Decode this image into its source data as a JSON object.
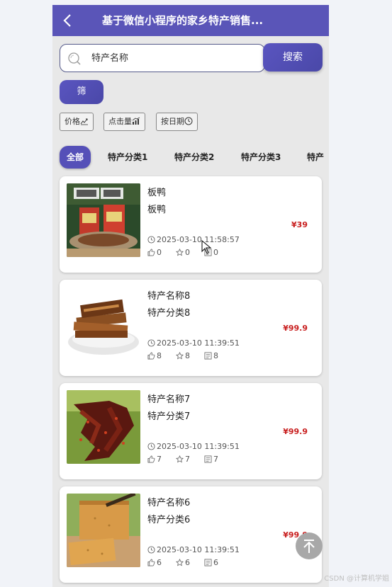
{
  "header": {
    "title": "基于微信小程序的家乡特产销售..."
  },
  "search": {
    "placeholder": "特产名称",
    "button_label": "搜索"
  },
  "filter": {
    "label": "筛"
  },
  "sort": [
    {
      "label": "价格",
      "icon": "trend-icon"
    },
    {
      "label": "点击量",
      "icon": "bar-chart-icon"
    },
    {
      "label": "按日期",
      "icon": "clock-icon"
    }
  ],
  "tabs": [
    "全部",
    "特产分类1",
    "特产分类2",
    "特产分类3",
    "特产"
  ],
  "items": [
    {
      "name": "板鸭",
      "category": "板鸭",
      "price": "¥39",
      "time": "2025-03-10 11:58:57",
      "likes": "0",
      "favorites": "0",
      "comments": "0",
      "image": "preserved-duck-photo"
    },
    {
      "name": "特产名称8",
      "category": "特产分类8",
      "price": "¥99.9",
      "time": "2025-03-10 11:39:51",
      "likes": "8",
      "favorites": "8",
      "comments": "8",
      "image": "braised-tofu-photo"
    },
    {
      "name": "特产名称7",
      "category": "特产分类7",
      "price": "¥99.9",
      "time": "2025-03-10 11:39:51",
      "likes": "7",
      "favorites": "7",
      "comments": "7",
      "image": "spicy-beef-photo"
    },
    {
      "name": "特产名称6",
      "category": "特产分类6",
      "price": "¥99.9",
      "time": "2025-03-10 11:39:51",
      "likes": "6",
      "favorites": "6",
      "comments": "6",
      "image": "cake-photo"
    }
  ],
  "watermark": "CSDN @计算机学姐",
  "colors": {
    "primary": "#5a55b8",
    "price": "#c81e1e"
  }
}
